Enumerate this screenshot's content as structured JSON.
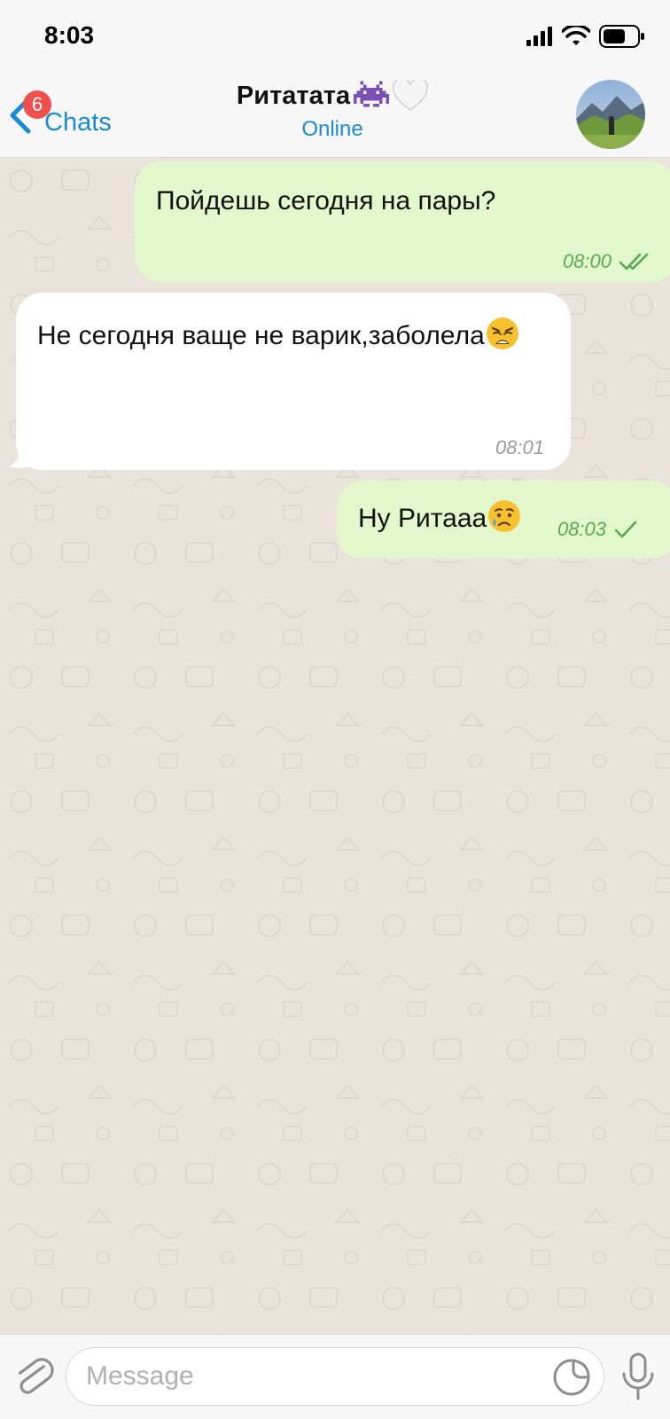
{
  "status_bar": {
    "time": "8:03"
  },
  "header": {
    "back_label": "Chats",
    "unread_badge": "6",
    "chat_name": "Ритатата",
    "chat_status": "Online",
    "title_emojis": [
      "alien-monster-icon",
      "white-heart-icon"
    ]
  },
  "messages": [
    {
      "direction": "outgoing",
      "text": "Пойдешь сегодня на пары?",
      "time": "08:00",
      "status": "read"
    },
    {
      "direction": "incoming",
      "text": "Не сегодня ваще не варик,заболела",
      "emoji": "weary-face-icon",
      "time": "08:01"
    },
    {
      "direction": "outgoing",
      "text": "Ну Ритааа",
      "emoji": "crying-face-icon",
      "time": "08:03",
      "status": "sent"
    }
  ],
  "input": {
    "placeholder": "Message"
  },
  "colors": {
    "accent": "#1a8ad6",
    "outgoing_bubble": "#e2f7cb",
    "incoming_bubble": "#ffffff",
    "badge": "#f0504d",
    "check": "#5aa854",
    "chat_background": "#e9e3dc"
  }
}
